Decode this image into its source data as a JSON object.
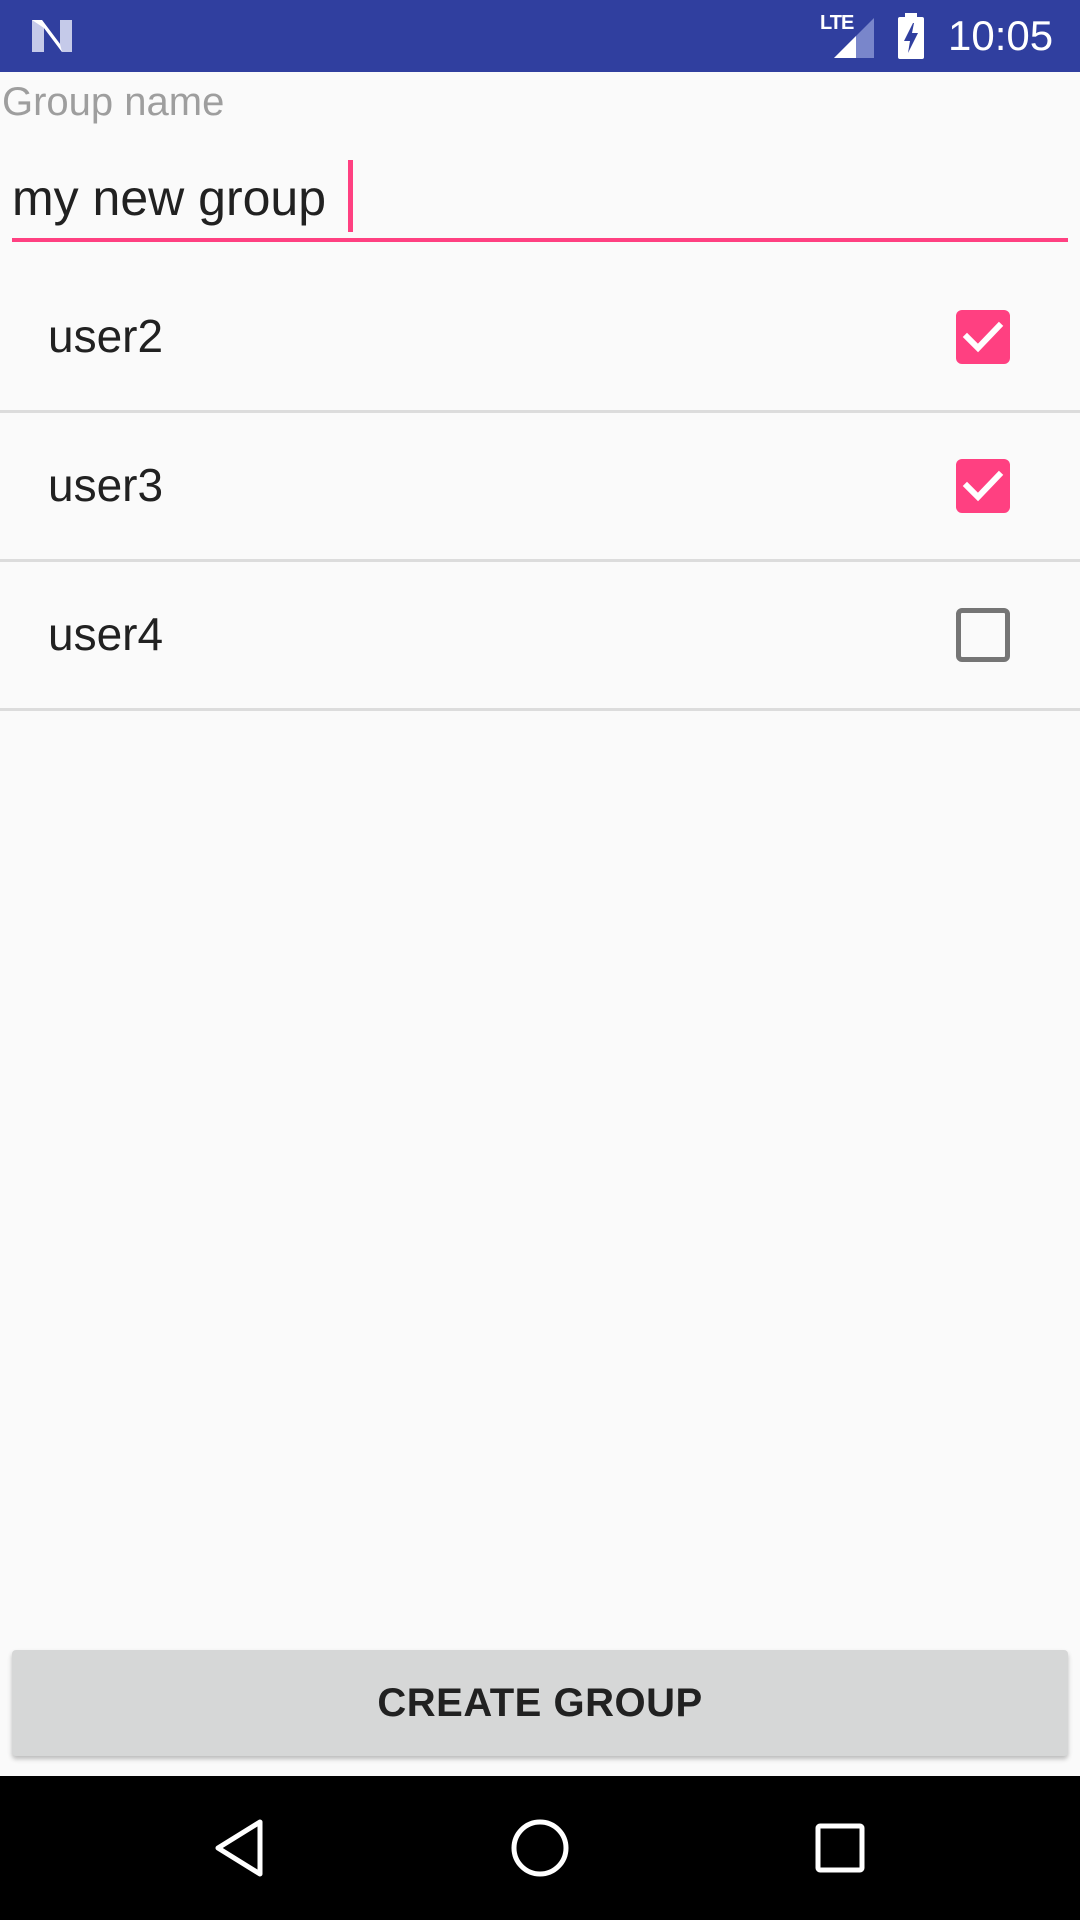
{
  "status_bar": {
    "network": "LTE",
    "time": "10:05",
    "icons": [
      "android-n-notification-icon",
      "signal-icon",
      "battery-charging-icon"
    ],
    "background_color": "#303f9f"
  },
  "group_name": {
    "label": "Group name",
    "value": "my new group"
  },
  "users": [
    {
      "name": "user2",
      "checked": true
    },
    {
      "name": "user3",
      "checked": true
    },
    {
      "name": "user4",
      "checked": false
    }
  ],
  "create_button": {
    "label": "CREATE GROUP"
  },
  "nav_bar": {
    "icons": [
      "back-icon",
      "home-icon",
      "recents-icon"
    ]
  },
  "colors": {
    "accent": "#ff4081",
    "primary_dark": "#303f9f"
  }
}
